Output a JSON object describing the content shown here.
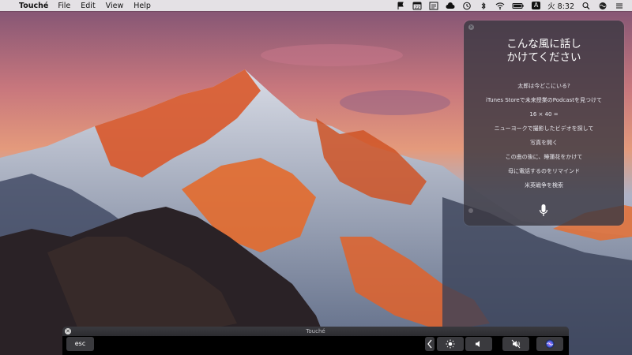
{
  "menubar": {
    "apple_icon": "apple-logo-icon",
    "app_name": "Touché",
    "menus": [
      "File",
      "Edit",
      "View",
      "Help"
    ],
    "status_icons": [
      "flag-icon",
      "calendar-icon",
      "checklist-icon",
      "cloud-icon",
      "clock-history-icon",
      "bluetooth-icon",
      "wifi-icon",
      "battery-icon",
      "input-method-icon"
    ],
    "calendar_day": "22",
    "input_method": "A",
    "clock": "火 8:32",
    "trailing_icons": [
      "search-icon",
      "siri-icon",
      "menu-list-icon"
    ]
  },
  "siri": {
    "headline": "こんな風に話し\nかけてください",
    "suggestions": [
      "太郎は今どこにいる?",
      "iTunes Storeで未来授業のPodcastを見つけて",
      "16 × 40 =",
      "ニューヨークで撮影したビデオを探して",
      "写真を開く",
      "この曲の後に、睡蓮花をかけて",
      "母に電話するのをリマインド",
      "米英戦争を検索"
    ],
    "mic_icon": "microphone-icon"
  },
  "touche": {
    "window_title": "Touché",
    "esc_label": "esc",
    "control_strip": [
      "chevron-left-icon",
      "brightness-icon",
      "volume-icon",
      "mute-icon",
      "siri-icon"
    ]
  }
}
